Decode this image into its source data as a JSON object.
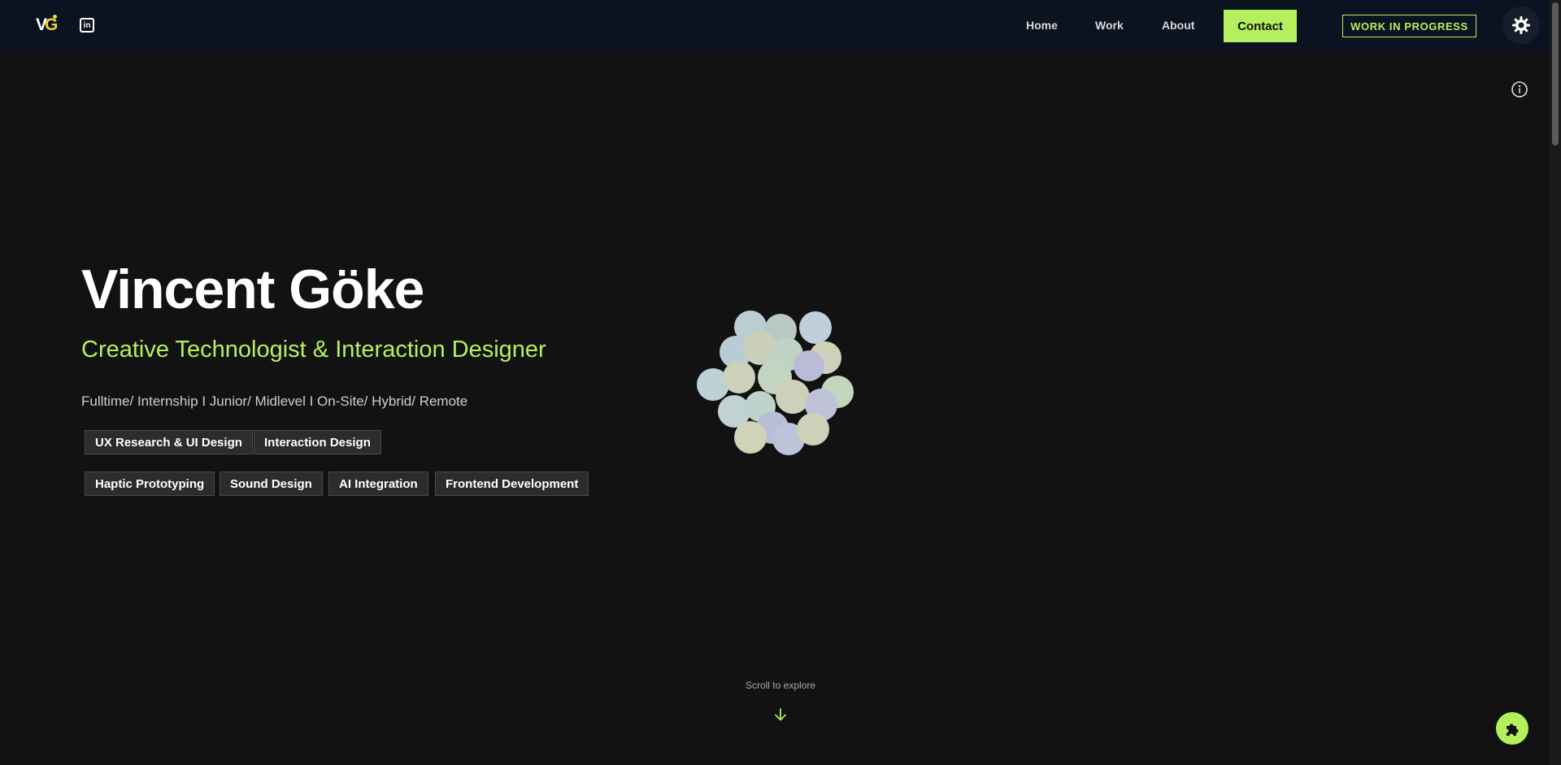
{
  "header": {
    "logo": {
      "v": "V",
      "g": "G"
    },
    "linkedin_label": "in",
    "nav": [
      {
        "label": "Home"
      },
      {
        "label": "Work"
      },
      {
        "label": "About"
      }
    ],
    "contact_label": "Contact",
    "status_badge": "WORK IN PROGRESS",
    "accent_color": "#b6ef5d"
  },
  "hero": {
    "name": "Vincent Göke",
    "role": "Creative Technologist & Interaction Designer",
    "availability": "Fulltime/ Internship I Junior/ Midlevel I On-Site/ Hybrid/ Remote",
    "tags_row1": [
      "UX Research & UI Design",
      "Interaction Design"
    ],
    "tags_row2": [
      "Haptic Prototyping",
      "Sound Design",
      "AI Integration",
      "Frontend Development"
    ]
  },
  "scroll_hint": "Scroll to explore",
  "icons": {
    "theme": "gear-icon",
    "info": "info-icon",
    "scroll": "arrow-down-icon",
    "puzzle": "puzzle-icon"
  }
}
